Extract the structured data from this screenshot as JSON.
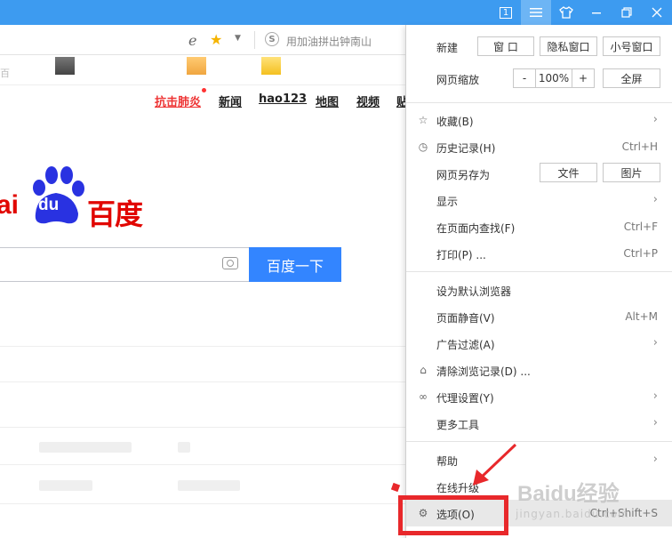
{
  "titlebar": {
    "window_count": "1",
    "icons": [
      "window-count-icon",
      "menu-icon",
      "skin-shirt-icon",
      "minimize-icon",
      "restore-icon"
    ]
  },
  "addressbar": {
    "search_hint": "用加油拼出钟南山",
    "s_label": "S"
  },
  "bookmarks_fragment": "百",
  "nav": {
    "items": [
      "抗击肺炎",
      "新闻",
      "hao123",
      "地图",
      "视频",
      "贴"
    ]
  },
  "logo": {
    "left_text": "ai",
    "du_text": "du",
    "right_text": "百度"
  },
  "search": {
    "button_label": "百度一下"
  },
  "menu": {
    "new_label": "新建",
    "new_buttons": [
      "窗 口",
      "隐私窗口",
      "小号窗口"
    ],
    "zoom_label": "网页缩放",
    "zoom_minus": "-",
    "zoom_value": "100%",
    "zoom_plus": "+",
    "fullscreen": "全屏",
    "favorites": "收藏(B)",
    "history": "历史记录(H)",
    "history_shortcut": "Ctrl+H",
    "save_as": "网页另存为",
    "save_file": "文件",
    "save_image": "图片",
    "display": "显示",
    "find": "在页面内查找(F)",
    "find_shortcut": "Ctrl+F",
    "print": "打印(P) ...",
    "print_shortcut": "Ctrl+P",
    "set_default": "设为默认浏览器",
    "mute": "页面静音(V)",
    "mute_shortcut": "Alt+M",
    "adblock": "广告过滤(A)",
    "clear_history": "清除浏览记录(D) ...",
    "proxy": "代理设置(Y)",
    "more_tools": "更多工具",
    "help": "帮助",
    "upgrade": "在线升级",
    "options": "选项(O)",
    "options_shortcut": "Ctrl+Shift+S"
  },
  "watermark": {
    "main": "Baidu经验",
    "sub": "jingyan.baidu.com"
  },
  "colors": {
    "titlebar": "#3d9bf0",
    "baidu_blue": "#3385ff",
    "baidu_red": "#e10601",
    "annotation_red": "#e8282b"
  }
}
